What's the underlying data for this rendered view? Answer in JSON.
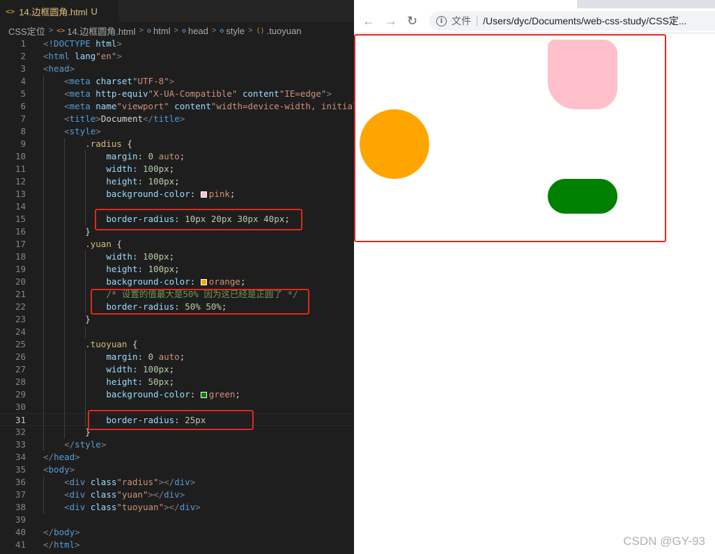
{
  "editor": {
    "tab": {
      "icon": "<>",
      "label": "14.边框圆角.html",
      "modified": "U",
      "close": "×"
    },
    "breadcrumb": {
      "items": [
        "CSS定位",
        "14.边框圆角.html",
        "html",
        "head",
        "style",
        ".tuoyuan"
      ]
    },
    "code_lines": [
      "<!DOCTYPE html>",
      "<html lang=\"en\">",
      "<head>",
      "    <meta charset=\"UTF-8\">",
      "    <meta http-equiv=\"X-UA-Compatible\" content=\"IE=edge\">",
      "    <meta name=\"viewport\" content=\"width=device-width, initial",
      "    <title>Document</title>",
      "    <style>",
      "        .radius {",
      "            margin: 0 auto;",
      "            width: 100px;",
      "            height: 100px;",
      "            background-color: pink;",
      "",
      "            border-radius: 10px 20px 30px 40px;",
      "        }",
      "        .yuan {",
      "            width: 100px;",
      "            height: 100px;",
      "            background-color: orange;",
      "            /* 设置的值最大是50% 因为这已经是正圆了 */",
      "            border-radius: 50% 50%;",
      "        }",
      "",
      "        .tuoyuan {",
      "            margin: 0 auto;",
      "            width: 100px;",
      "            height: 50px;",
      "            background-color: green;",
      "",
      "            border-radius: 25px",
      "        }",
      "    </style>",
      "</head>",
      "<body>",
      "    <div class=\"radius\"></div>",
      "    <div class=\"yuan\"></div>",
      "    <div class=\"tuoyuan\"></div>",
      "",
      "</body>",
      "</html>"
    ],
    "active_line": 31
  },
  "browser": {
    "address": {
      "scheme_label": "文件",
      "url": "/Users/dyc/Documents/web-css-study/CSS定..."
    },
    "nav": {
      "back_icon": "←",
      "forward_icon": "→",
      "reload_icon": "↻"
    },
    "colors": {
      "radius": "#ffc0cb",
      "yuan": "#ffa500",
      "tuoyuan": "#008000",
      "highlight": "#e0281d"
    }
  },
  "watermark": "CSDN @GY-93"
}
